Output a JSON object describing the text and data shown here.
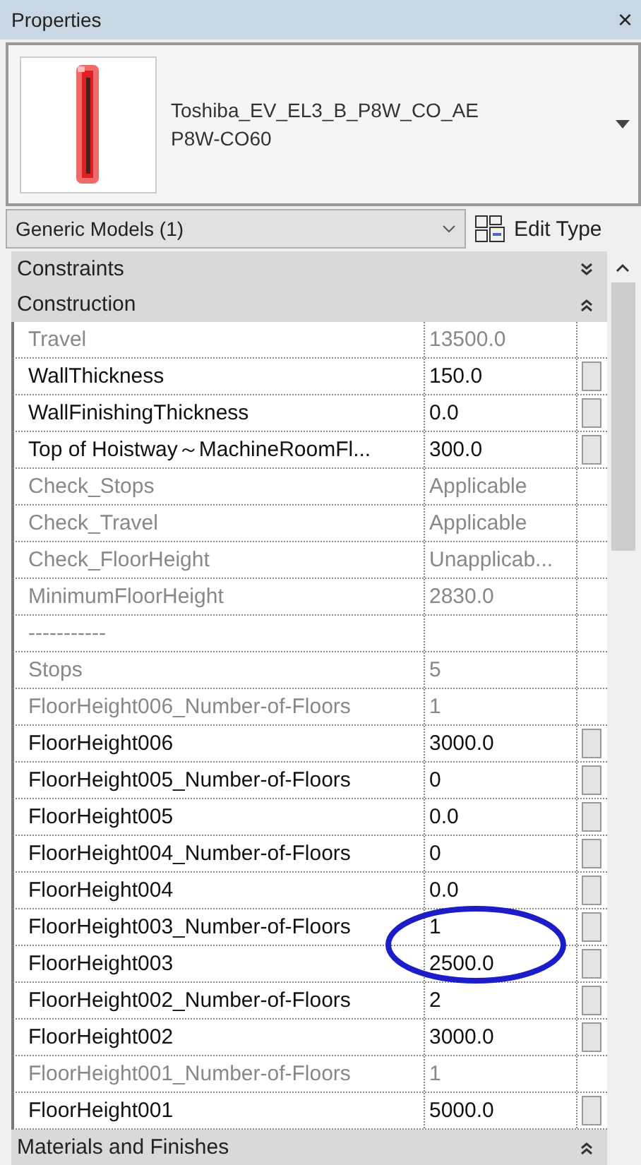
{
  "window": {
    "title": "Properties",
    "close": "×"
  },
  "type_selector": {
    "family": "Toshiba_EV_EL3_B_P8W_CO_AE",
    "type": "P8W-CO60"
  },
  "filter": {
    "value": "Generic Models (1)",
    "edit_type": "Edit Type"
  },
  "categories": [
    {
      "label": "Constraints",
      "expanded": false
    },
    {
      "label": "Construction",
      "expanded": true
    }
  ],
  "rows": [
    {
      "name": "Travel",
      "value": "13500.0",
      "editable": false
    },
    {
      "name": "WallThickness",
      "value": "150.0",
      "editable": true
    },
    {
      "name": "WallFinishingThickness",
      "value": "0.0",
      "editable": true
    },
    {
      "name": "Top of Hoistway～MachineRoomFl...",
      "value": "300.0",
      "editable": true
    },
    {
      "name": "Check_Stops",
      "value": "Applicable",
      "editable": false
    },
    {
      "name": "Check_Travel",
      "value": "Applicable",
      "editable": false
    },
    {
      "name": "Check_FloorHeight",
      "value": "Unapplicab...",
      "editable": false
    },
    {
      "name": "MinimumFloorHeight",
      "value": "2830.0",
      "editable": false
    },
    {
      "name": "-----------",
      "editable": false
    },
    {
      "name": "Stops",
      "value": "5",
      "editable": false
    },
    {
      "name": "FloorHeight006_Number-of-Floors",
      "value": "1",
      "editable": false
    },
    {
      "name": "FloorHeight006",
      "value": "3000.0",
      "editable": true
    },
    {
      "name": "FloorHeight005_Number-of-Floors",
      "value": "0",
      "editable": true
    },
    {
      "name": "FloorHeight005",
      "value": "0.0",
      "editable": true
    },
    {
      "name": "FloorHeight004_Number-of-Floors",
      "value": "0",
      "editable": true
    },
    {
      "name": "FloorHeight004",
      "value": "0.0",
      "editable": true
    },
    {
      "name": "FloorHeight003_Number-of-Floors",
      "value": "1",
      "editable": true,
      "circled": true
    },
    {
      "name": "FloorHeight003",
      "value": "2500.0",
      "editable": true,
      "circled": true
    },
    {
      "name": "FloorHeight002_Number-of-Floors",
      "value": "2",
      "editable": true
    },
    {
      "name": "FloorHeight002",
      "value": "3000.0",
      "editable": true
    },
    {
      "name": "FloorHeight001_Number-of-Floors",
      "value": "1",
      "editable": false
    },
    {
      "name": "FloorHeight001",
      "value": "5000.0",
      "editable": true
    }
  ],
  "footer_category": {
    "label": "Materials and Finishes",
    "expanded": true
  }
}
